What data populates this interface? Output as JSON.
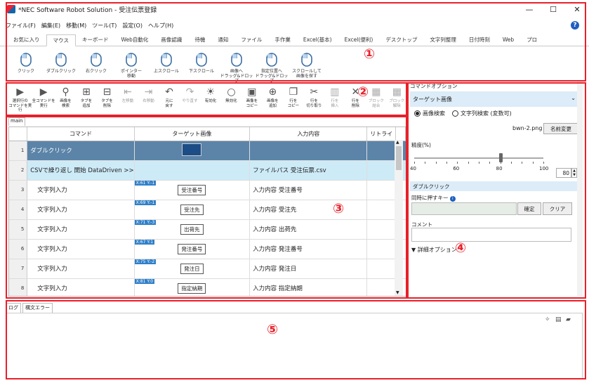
{
  "window": {
    "title": "*NEC Software Robot Solution - 受注伝票登録",
    "min": "—",
    "max": "☐",
    "close": "✕"
  },
  "menu": [
    "ファイル(F)",
    "編集(E)",
    "移動(M)",
    "ツール(T)",
    "設定(O)",
    "ヘルプ(H)"
  ],
  "help_label": "?",
  "tabs": [
    "お気に入り",
    "マウス",
    "キーボード",
    "Web自動化",
    "画像認識",
    "待機",
    "通知",
    "ファイル",
    "手作業",
    "Excel(基本)",
    "Excel(便利)",
    "デスクトップ",
    "文字列整理",
    "日付時刻",
    "Web",
    "プロ"
  ],
  "active_tab": 1,
  "ribbon": [
    {
      "label": "クリック",
      "icon": "mouse-click-icon"
    },
    {
      "label": "ダブルクリック",
      "icon": "mouse-double-click-icon"
    },
    {
      "label": "右クリック",
      "icon": "mouse-right-click-icon"
    },
    {
      "label": "ポインター\n移動",
      "icon": "pointer-move-icon"
    },
    {
      "label": "上スクロール",
      "icon": "scroll-up-icon"
    },
    {
      "label": "下スクロール",
      "icon": "scroll-down-icon"
    },
    {
      "label": "画像へ\nドラッグ&ドロップ",
      "icon": "drag-to-image-icon"
    },
    {
      "label": "指定位置へ\nドラッグ&ドロップ",
      "icon": "drag-to-position-icon"
    },
    {
      "label": "スクロールして\n画像を探す",
      "icon": "scroll-search-image-icon"
    }
  ],
  "toolbar": [
    {
      "label": "選択行の\nコマンドを実行",
      "icon": "run-selected-icon",
      "disabled": false
    },
    {
      "label": "全コマンドを\n実行",
      "icon": "run-all-icon",
      "disabled": false
    },
    {
      "label": "画像を\n検索",
      "icon": "search-image-icon",
      "disabled": false
    },
    {
      "label": "タブを\n追加",
      "icon": "add-tab-icon",
      "disabled": false
    },
    {
      "label": "タブを\n削除",
      "icon": "delete-tab-icon",
      "disabled": false
    },
    {
      "label": "左移動",
      "icon": "move-left-icon",
      "disabled": true
    },
    {
      "label": "右移動",
      "icon": "move-right-icon",
      "disabled": true
    },
    {
      "label": "元に\n戻す",
      "icon": "undo-icon",
      "disabled": false
    },
    {
      "label": "やり直す",
      "icon": "redo-icon",
      "disabled": true
    },
    {
      "label": "有効化",
      "icon": "enable-icon",
      "disabled": false
    },
    {
      "label": "無効化",
      "icon": "disable-icon",
      "disabled": false
    },
    {
      "label": "画像を\nコピー",
      "icon": "copy-image-icon",
      "disabled": false
    },
    {
      "label": "画像を\n追加",
      "icon": "add-image-icon",
      "disabled": false
    },
    {
      "label": "行を\nコピー",
      "icon": "copy-row-icon",
      "disabled": false
    },
    {
      "label": "行を\n切り取り",
      "icon": "cut-row-icon",
      "disabled": false
    },
    {
      "label": "行を\n挿入",
      "icon": "insert-row-icon",
      "disabled": true
    },
    {
      "label": "行を\n削除",
      "icon": "delete-row-icon",
      "disabled": false
    },
    {
      "label": "ブロック\n結合",
      "icon": "block-merge-icon",
      "disabled": true
    },
    {
      "label": "ブロック\n解除",
      "icon": "block-unmerge-icon",
      "disabled": true
    }
  ],
  "grid_tab": "main",
  "grid": {
    "headers": [
      "コマンド",
      "ターゲット画像",
      "入力内容",
      "リトライ"
    ],
    "rows": [
      {
        "num": "1",
        "cmd": "ダブルクリック",
        "target": "",
        "thumb": true,
        "input": "",
        "style": "sel"
      },
      {
        "num": "2",
        "cmd": "CSVで繰り返し 開始 DataDriven >>",
        "target": "",
        "input": "ファイルパス 受注伝票.csv",
        "style": "hl"
      },
      {
        "num": "3",
        "cmd": "文字列入力",
        "target": "受注番号",
        "coord": "X:61 Y:-1",
        "input": "入力内容 受注番号"
      },
      {
        "num": "4",
        "cmd": "文字列入力",
        "target": "受注先",
        "coord": "X:69 Y:-1",
        "input": "入力内容 受注先"
      },
      {
        "num": "5",
        "cmd": "文字列入力",
        "target": "出荷先",
        "coord": "X:71 Y:-3",
        "input": "入力内容 出荷先"
      },
      {
        "num": "6",
        "cmd": "文字列入力",
        "target": "発注番号",
        "coord": "X:67 Y:1",
        "input": "入力内容 発注番号"
      },
      {
        "num": "7",
        "cmd": "文字列入力",
        "target": "発注日",
        "coord": "X:75 Y:-2",
        "input": "入力内容 発注日"
      },
      {
        "num": "8",
        "cmd": "文字列入力",
        "target": "指定納期",
        "coord": "X:81 Y:0",
        "input": "入力内容 指定納期"
      }
    ]
  },
  "panel": {
    "title": "コマンドオプション",
    "section1": "ターゲット画像",
    "radio1": "画像検索",
    "radio2": "文字列検索 (変数可)",
    "filename": "bwn-2.png",
    "rename": "名前変更",
    "accuracy_label": "精度(%)",
    "accuracy_value": "80",
    "slider_fraction": 0.8,
    "ticks": [
      "40",
      "60",
      "80",
      "100"
    ],
    "section2": "ダブルクリック",
    "simul_label": "同時に押すキー",
    "confirm": "確定",
    "clear": "クリア",
    "comment_label": "コメント",
    "detail": "▼ 詳細オプション"
  },
  "log": {
    "tab1": "ログ",
    "tab2": "構文エラー"
  },
  "markers": [
    "①",
    "②",
    "③",
    "④",
    "⑤"
  ],
  "colors": {
    "red": "#e8202a",
    "selected_row": "#5b84a8",
    "highlight_row": "#cdeaf7",
    "accent": "#1f5fbf"
  }
}
